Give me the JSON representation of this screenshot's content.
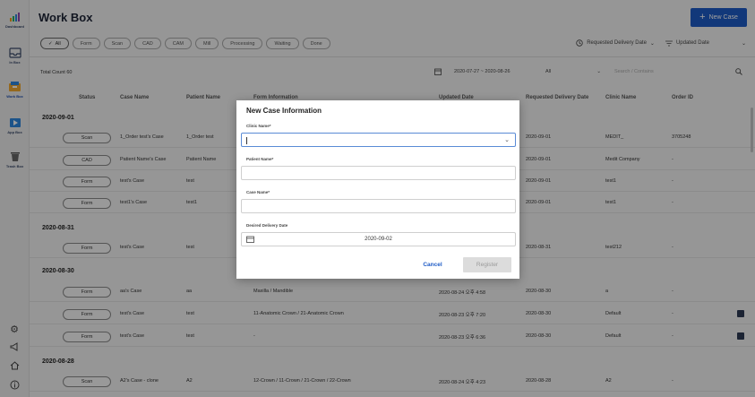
{
  "sidebar": {
    "items": [
      {
        "label": "Dashboard",
        "icon": "chart-icon"
      },
      {
        "label": "In Box",
        "icon": "inbox-icon"
      },
      {
        "label": "Work Box",
        "icon": "workbox-icon"
      },
      {
        "label": "App Box",
        "icon": "appbox-icon"
      },
      {
        "label": "Trash Box",
        "icon": "trash-icon"
      }
    ],
    "bottom_icons": [
      "gear-icon",
      "megaphone-icon",
      "home-icon",
      "info-icon"
    ]
  },
  "header": {
    "title": "Work Box",
    "new_case_label": "New Case"
  },
  "filters": [
    "All",
    "Form",
    "Scan",
    "CAD",
    "CAM",
    "Mill",
    "Processing",
    "Waiting",
    "Done"
  ],
  "sort": {
    "requested": "Requested Delivery Date",
    "updated": "Updated Date"
  },
  "toolbar": {
    "total_count": "Total Count 60",
    "date_range": "2020-07-27 ~ 2020-08-26",
    "filter_value": "All",
    "search_placeholder": "Search / Contains"
  },
  "columns": [
    "Status",
    "Case Name",
    "Patient Name",
    "Form Information",
    "Updated Date",
    "Requested Delivery Date",
    "Clinic Name",
    "Order ID"
  ],
  "groups": [
    {
      "date": "2020-09-01",
      "rows": [
        {
          "status": "Scan",
          "case": "1_Order test's Case",
          "patient": "1_Order test",
          "form": "",
          "updated": "",
          "requested": "2020-09-01",
          "clinic": "MEDIT_",
          "order": "3705248",
          "msg": false
        },
        {
          "status": "CAD",
          "case": "Patient Name's Case",
          "patient": "Patient Name",
          "form": "",
          "updated": "",
          "requested": "2020-09-01",
          "clinic": "Medit Company",
          "order": "-",
          "msg": false
        },
        {
          "status": "Form",
          "case": "test's Case",
          "patient": "test",
          "form": "",
          "updated": "",
          "requested": "2020-09-01",
          "clinic": "test1",
          "order": "-",
          "msg": false
        },
        {
          "status": "Form",
          "case": "test1's Case",
          "patient": "test1",
          "form": "",
          "updated": "",
          "requested": "2020-09-01",
          "clinic": "test1",
          "order": "-",
          "msg": false
        }
      ]
    },
    {
      "date": "2020-08-31",
      "rows": [
        {
          "status": "Form",
          "case": "test's Case",
          "patient": "test",
          "form": "",
          "updated": "",
          "requested": "2020-08-31",
          "clinic": "test212",
          "order": "-",
          "msg": false
        }
      ]
    },
    {
      "date": "2020-08-30",
      "rows": [
        {
          "status": "Form",
          "case": "aa's Case",
          "patient": "aa",
          "form": "Maxilla / Mandible",
          "updated": "2020-08-24 오후 4:58",
          "requested": "2020-08-30",
          "clinic": "a",
          "order": "-",
          "msg": false
        },
        {
          "status": "Form",
          "case": "test's Case",
          "patient": "test",
          "form": "11-Anatomic Crown / 21-Anatomic Crown",
          "updated": "2020-08-23 오후 7:20",
          "requested": "2020-08-30",
          "clinic": "Default",
          "order": "-",
          "msg": true
        },
        {
          "status": "Form",
          "case": "test's Case",
          "patient": "test",
          "form": "-",
          "updated": "2020-08-23 오후 6:36",
          "requested": "2020-08-30",
          "clinic": "Default",
          "order": "-",
          "msg": true
        }
      ]
    },
    {
      "date": "2020-08-28",
      "rows": [
        {
          "status": "Scan",
          "case": "A2's Case - clone",
          "patient": "A2",
          "form": "12-Crown / 11-Crown / 21-Crown / 22-Crown",
          "updated": "2020-08-24 오후 4:23",
          "requested": "2020-08-28",
          "clinic": "A2",
          "order": "-",
          "msg": false
        }
      ]
    }
  ],
  "modal": {
    "title": "New Case Information",
    "clinic_label": "Clinic Name*",
    "clinic_value": "",
    "patient_label": "Patient Name*",
    "patient_value": "",
    "case_label": "Case Name*",
    "case_value": "",
    "date_label": "Desired Delivery Date",
    "date_value": "2020-09-02",
    "cancel_label": "Cancel",
    "register_label": "Register"
  },
  "colors": {
    "accent": "#1e5bc6",
    "overlay": "rgba(0,0,0,0.38)"
  }
}
